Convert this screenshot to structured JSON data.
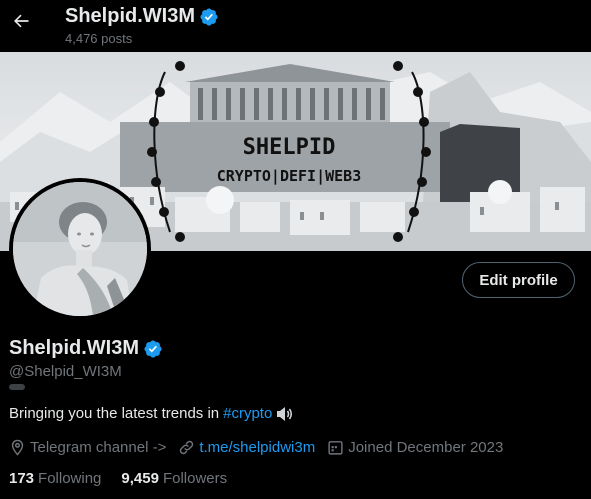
{
  "header": {
    "back_icon": "arrow-left-icon",
    "name": "Shelpid.WI3M",
    "posts": "4,476 posts"
  },
  "banner": {
    "title": "SHELPID",
    "subtitle": "CRYPTO|DEFI|WEB3"
  },
  "profile": {
    "display_name": "Shelpid.WI3M",
    "handle": "@Shelpid_WI3M",
    "edit_label": "Edit profile",
    "bio_text": "Bringing you the latest trends in",
    "bio_tag": "#crypto",
    "location": "Telegram channel ->",
    "link": "t.me/shelpidwi3m",
    "joined": "Joined December 2023",
    "following_count": "173",
    "following_label": "Following",
    "followers_count": "9,459",
    "followers_label": "Followers"
  },
  "colors": {
    "accent": "#1d9bf0",
    "verified": "#1d9bf0",
    "muted": "#71767b",
    "background": "#000000"
  }
}
